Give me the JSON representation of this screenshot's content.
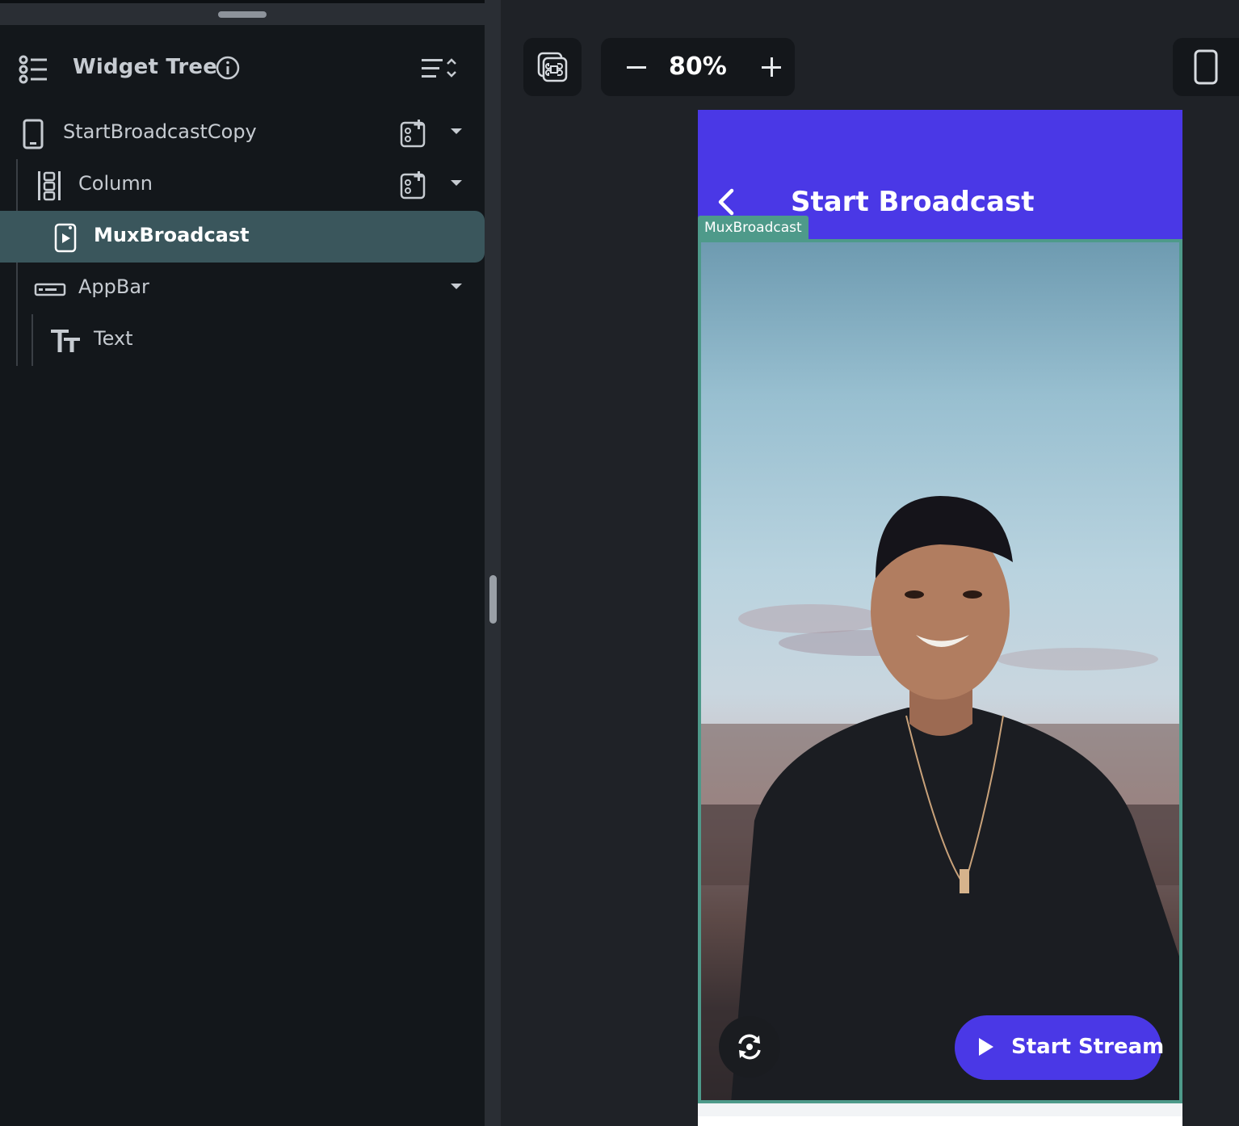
{
  "widget_tree": {
    "title": "Widget Tree",
    "items": [
      {
        "label": "StartBroadcastCopy",
        "icon": "phone-icon"
      },
      {
        "label": "Column",
        "icon": "column-icon"
      },
      {
        "label": "MuxBroadcast",
        "icon": "video-widget-icon",
        "selected": true
      },
      {
        "label": "AppBar",
        "icon": "appbar-icon"
      },
      {
        "label": "Text",
        "icon": "text-icon"
      }
    ]
  },
  "toolbar": {
    "zoom_value": "80%"
  },
  "preview": {
    "appbar_title": "Start Broadcast",
    "selection_tag": "MuxBroadcast",
    "start_stream_label": "Start Stream"
  },
  "colors": {
    "accent": "#4a38e6",
    "selection": "#4e9a8a",
    "selected_row": "#3a565c",
    "panel_bg": "#13171b",
    "canvas_bg": "#1f2227"
  }
}
